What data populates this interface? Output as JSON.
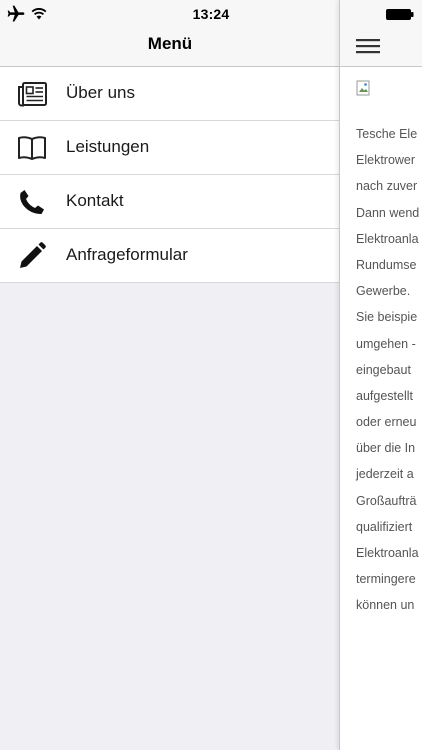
{
  "status_bar": {
    "time": "13:24",
    "icons": [
      "airplane-icon",
      "wifi-icon",
      "battery-icon"
    ]
  },
  "drawer": {
    "title": "Menü",
    "items": [
      {
        "label": "Über uns",
        "icon": "newspaper-icon"
      },
      {
        "label": "Leistungen",
        "icon": "book-icon"
      },
      {
        "label": "Kontakt",
        "icon": "phone-icon"
      },
      {
        "label": "Anfrageformular",
        "icon": "pencil-icon"
      }
    ]
  },
  "content": {
    "menu_icon": "hamburger-icon",
    "image_placeholder_icon": "broken-image-icon",
    "text_lines": [
      "Tesche Ele",
      "Elektrower",
      "nach zuver",
      "Dann wend",
      "Elektroanla",
      "Rundumse",
      "Gewerbe.",
      "Sie beispie",
      "umgehen -",
      "eingebaut",
      "aufgestellt",
      "oder erneu",
      "über die In",
      "jederzeit a",
      "Großaufträ",
      "qualifiziert",
      "Elektroanla",
      "termingere",
      "können un"
    ]
  },
  "colors": {
    "background": "#efeff4",
    "bar": "#f7f7f7",
    "separator": "#c8c7cc",
    "text": "#1a1a1a"
  }
}
